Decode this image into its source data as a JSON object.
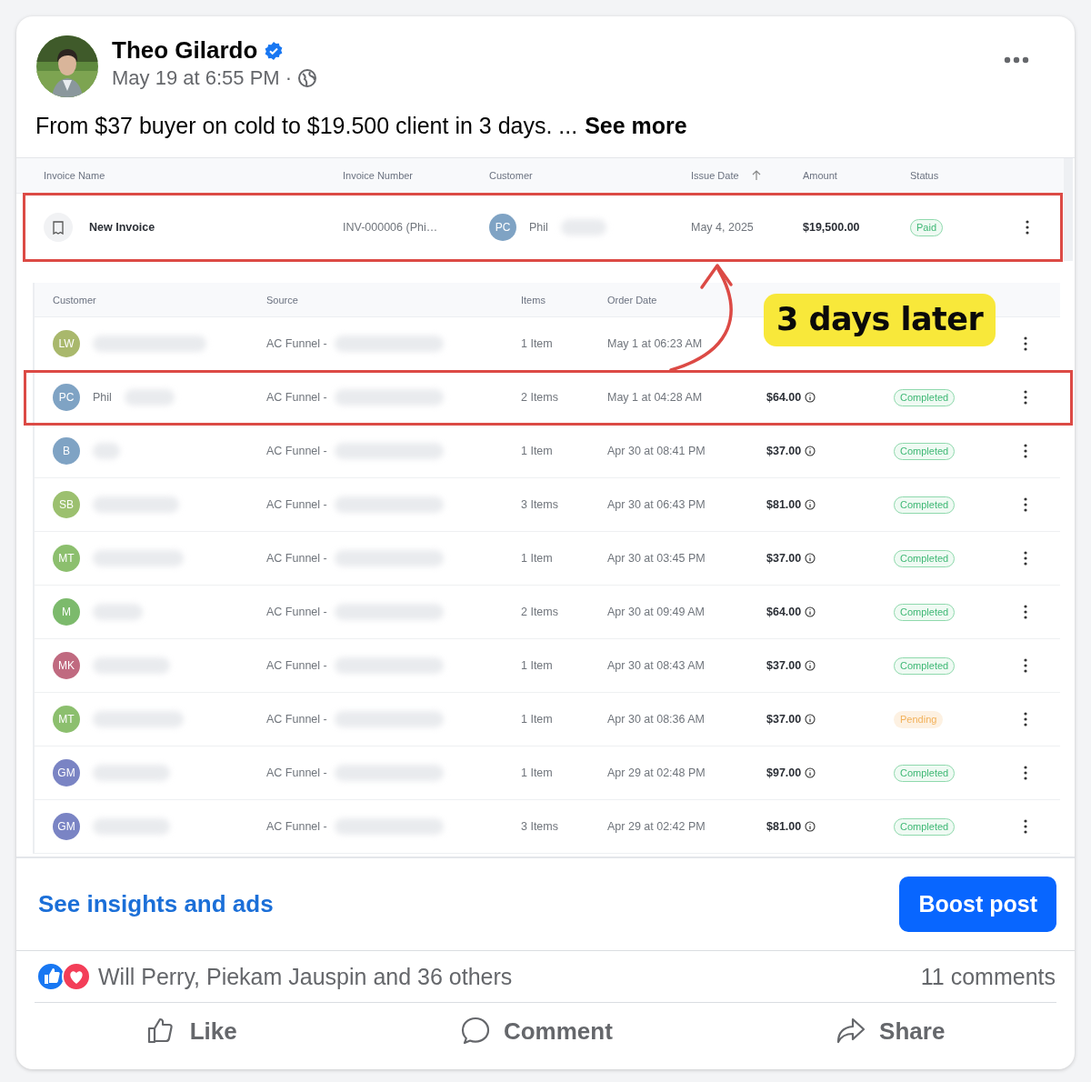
{
  "post": {
    "author": "Theo Gilardo",
    "verified": true,
    "time": "May 19 at 6:55 PM",
    "separator": "·",
    "text": "From $37 buyer on cold to $19.500 client in 3 days. ...",
    "see_more": "See more"
  },
  "invoice_table": {
    "columns": [
      {
        "label": "Invoice Name",
        "sorted": false
      },
      {
        "label": "Invoice Number",
        "sorted": false
      },
      {
        "label": "Customer",
        "sorted": false
      },
      {
        "label": "Issue Date",
        "sorted": true
      },
      {
        "label": "Amount",
        "sorted": false
      },
      {
        "label": "Status",
        "sorted": false
      }
    ],
    "rows": [
      {
        "name": "New Invoice",
        "number": "INV-000006 (Phi…",
        "initials": "PC",
        "color": "#7fa3c4",
        "customer": "Phil",
        "issue_date": "May 4, 2025",
        "amount": "$19,500.00",
        "status": "Paid",
        "kind": "success",
        "highlighted": true
      }
    ]
  },
  "orders_table": {
    "columns": [
      "Customer",
      "Source",
      "Items",
      "Order Date"
    ],
    "rows": [
      {
        "initials": "LW",
        "color": "#a9b86c",
        "source": "AC Funnel -",
        "items": "1 Item",
        "order_date": "May 1 at 06:23 AM",
        "highlighted": false
      },
      {
        "initials": "PC",
        "color": "#7fa3c4",
        "customer": "Phil",
        "source": "AC Funnel -",
        "items": "2 Items",
        "order_date": "May 1 at 04:28 AM",
        "amount": "$64.00",
        "status": "Completed",
        "kind": "success",
        "highlighted": true
      },
      {
        "initials": "B",
        "color": "#7fa3c4",
        "source": "AC Funnel -",
        "items": "1 Item",
        "order_date": "Apr 30 at 08:41 PM",
        "amount": "$37.00",
        "status": "Completed",
        "kind": "success",
        "highlighted": false
      },
      {
        "initials": "SB",
        "color": "#9cc06f",
        "source": "AC Funnel -",
        "items": "3 Items",
        "order_date": "Apr 30 at 06:43 PM",
        "amount": "$81.00",
        "status": "Completed",
        "kind": "success",
        "highlighted": false
      },
      {
        "initials": "MT",
        "color": "#8cbf6e",
        "source": "AC Funnel -",
        "items": "1 Item",
        "order_date": "Apr 30 at 03:45 PM",
        "amount": "$37.00",
        "status": "Completed",
        "kind": "success",
        "highlighted": false
      },
      {
        "initials": "M",
        "color": "#7cba6c",
        "source": "AC Funnel -",
        "items": "2 Items",
        "order_date": "Apr 30 at 09:49 AM",
        "amount": "$64.00",
        "status": "Completed",
        "kind": "success",
        "highlighted": false
      },
      {
        "initials": "MK",
        "color": "#c06a80",
        "source": "AC Funnel -",
        "items": "1 Item",
        "order_date": "Apr 30 at 08:43 AM",
        "amount": "$37.00",
        "status": "Completed",
        "kind": "success",
        "highlighted": false
      },
      {
        "initials": "MT",
        "color": "#8cbf6e",
        "source": "AC Funnel -",
        "items": "1 Item",
        "order_date": "Apr 30 at 08:36 AM",
        "amount": "$37.00",
        "status": "Pending",
        "kind": "pending",
        "highlighted": false
      },
      {
        "initials": "GM",
        "color": "#7a84c4",
        "source": "AC Funnel -",
        "items": "1 Item",
        "order_date": "Apr 29 at 02:48 PM",
        "amount": "$97.00",
        "status": "Completed",
        "kind": "success",
        "highlighted": false
      },
      {
        "initials": "GM",
        "color": "#7a84c4",
        "source": "AC Funnel -",
        "items": "3 Items",
        "order_date": "Apr 29 at 02:42 PM",
        "amount": "$81.00",
        "status": "Completed",
        "kind": "success",
        "highlighted": false
      }
    ]
  },
  "annotation": {
    "caption": "3 days later"
  },
  "footer": {
    "insights_link": "See insights and ads",
    "boost_button": "Boost post",
    "reactions": "Will Perry, Piekam Jauspin and 36 others",
    "comments": "11 comments",
    "actions": [
      {
        "kind": "like",
        "label": "Like"
      },
      {
        "kind": "comment",
        "label": "Comment"
      },
      {
        "kind": "share",
        "label": "Share"
      }
    ]
  }
}
